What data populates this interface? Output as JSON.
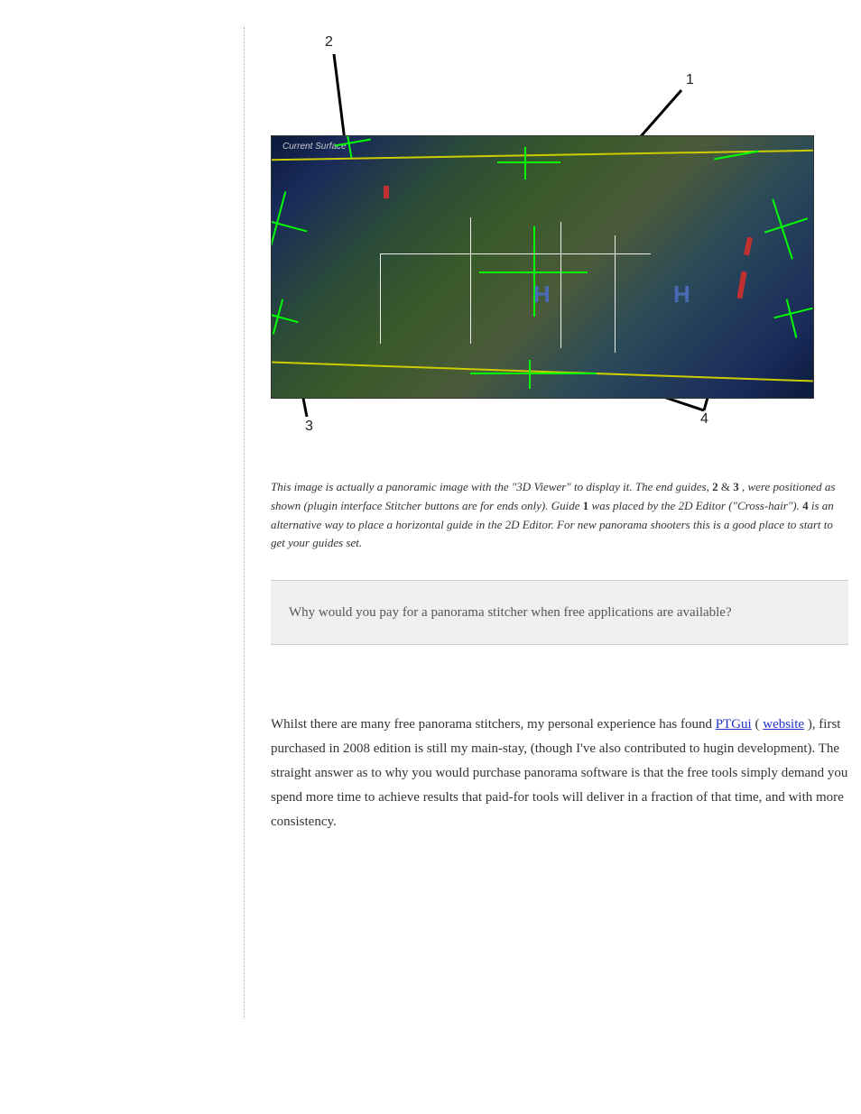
{
  "figure": {
    "labels": {
      "1": "1",
      "2": "2",
      "3": "3",
      "4": "4"
    },
    "map_title": "Current Surface",
    "pressure_marks": [
      "H",
      "H"
    ],
    "caption_lead": "This image is actually a panoramic image with the \"3D Viewer\" to display it. The end guides,",
    "caption_2": "2",
    "caption_3": "3",
    "caption_mid": ", were positioned as shown (plugin interface Stitcher buttons are for ends only). Guide",
    "caption_1": "1",
    "caption_mid2": "was placed by the 2D Editor (\"Cross-hair\"). ",
    "caption_4": "4",
    "caption_mid3": " is an alternative way to place a horizontal guide in the 2D Editor. For new panorama shooters this is a good place to start to get your guides set."
  },
  "grey_bar": {
    "text": "Why would you pay for a panorama stitcher when free applications are available?"
  },
  "body": {
    "p1_pre": "Whilst there are many free panorama stitchers, my personal experience has found ",
    "p1_link1_text": "PTGui",
    "p1_link1_href": "#",
    "p1_mid": " (",
    "p1_link2_text": "website",
    "p1_link2_href": "#",
    "p1_end": "), first purchased in 2008 edition is still my main-stay, (though I've also contributed to hugin development). The straight answer as to why you would purchase panorama software is that the free tools simply demand you spend more time to achieve results that paid-for tools will deliver in a fraction of that time, and with more consistency."
  }
}
